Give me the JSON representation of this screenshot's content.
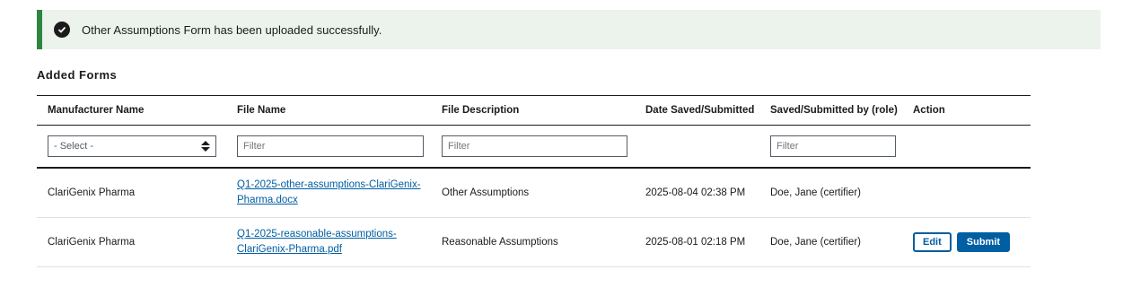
{
  "alert": {
    "message": "Other Assumptions Form has been uploaded successfully.",
    "icon": "check-circle-icon",
    "accent_color": "#2e8540",
    "background_color": "#ecf3ec"
  },
  "section_title": "Added Forms",
  "table": {
    "headers": {
      "manufacturer": "Manufacturer Name",
      "file_name": "File Name",
      "file_description": "File Description",
      "date": "Date Saved/Submitted",
      "saved_by": "Saved/Submitted by (role)",
      "action": "Action"
    },
    "filters": {
      "manufacturer_select": "- Select -",
      "file_name_placeholder": "Filter",
      "file_description_placeholder": "Filter",
      "saved_by_placeholder": "Filter"
    },
    "rows": [
      {
        "manufacturer": "ClariGenix Pharma",
        "file_name_line1": "Q1-2025-other-assumptions-ClariGenix-",
        "file_name_line2": "Pharma.docx",
        "file_description": "Other Assumptions",
        "date": "2025-08-04 02:38 PM",
        "saved_by": "Doe, Jane (certifier)"
      },
      {
        "manufacturer": "ClariGenix Pharma",
        "file_name_line1": "Q1-2025-reasonable-assumptions-",
        "file_name_line2": "ClariGenix-Pharma.pdf",
        "file_description": "Reasonable Assumptions",
        "date": "2025-08-01 02:18 PM",
        "saved_by": "Doe, Jane (certifier)",
        "actions": {
          "edit": "Edit",
          "submit": "Submit"
        }
      }
    ]
  },
  "colors": {
    "link": "#005ea2",
    "primary_button": "#005ea2"
  }
}
